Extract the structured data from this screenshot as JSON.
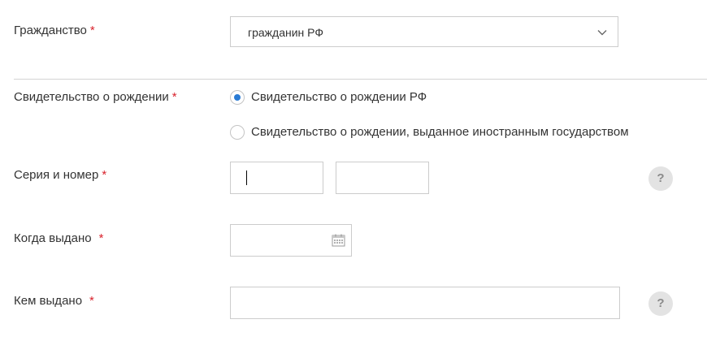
{
  "form": {
    "citizenship": {
      "label": "Гражданство",
      "required_mark": "*",
      "selected": "гражданин РФ",
      "icon": "chevron-down-icon"
    },
    "birth_certificate": {
      "label": "Свидетельство о рождении",
      "required_mark": "*",
      "options": [
        {
          "label": "Свидетельство о рождении РФ",
          "checked": true
        },
        {
          "label": "Свидетельство о рождении, выданное иностранным государством",
          "checked": false
        }
      ]
    },
    "series_number": {
      "label": "Серия и номер",
      "required_mark": "*",
      "series_value": "",
      "number_value": "",
      "help": "?"
    },
    "issue_date": {
      "label": "Когда выдано",
      "required_mark": "*",
      "value": "",
      "icon": "calendar-icon"
    },
    "issued_by": {
      "label": "Кем выдано",
      "required_mark": "*",
      "value": "",
      "help": "?"
    }
  },
  "colors": {
    "accent": "#2a7bd4",
    "required": "#d9232d",
    "border": "#cccccc",
    "divider": "#d4d4d4",
    "help_bg": "#e3e3e3"
  }
}
